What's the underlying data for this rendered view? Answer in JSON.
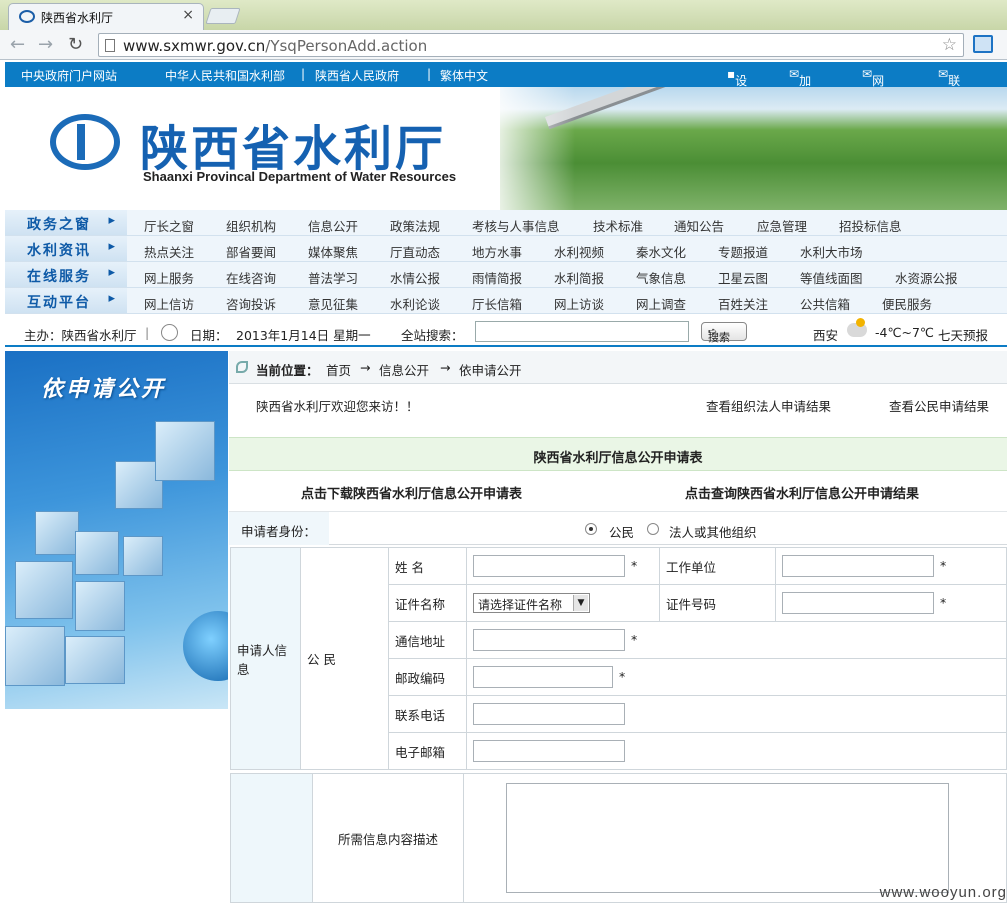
{
  "browser": {
    "tab_title": "陕西省水利厅",
    "url_host": "www.sxmwr.gov.cn",
    "url_path": "/YsqPersonAdd.action"
  },
  "top_links": {
    "left": [
      "中央政府门户网站",
      "中华人民共和国水利部",
      "陕西省人民政府",
      "繁体中文"
    ],
    "right": [
      "设为首页",
      "加入收藏",
      "网站地图",
      "联系我们"
    ]
  },
  "banner": {
    "title": "陕西省水利厅",
    "subtitle": "Shaanxi Provincal Department of Water Resources"
  },
  "nav": [
    {
      "category": "政务之窗",
      "items": [
        "厅长之窗",
        "组织机构",
        "信息公开",
        "政策法规",
        "考核与人事信息",
        "技术标准",
        "通知公告",
        "应急管理",
        "招投标信息"
      ]
    },
    {
      "category": "水利资讯",
      "items": [
        "热点关注",
        "部省要闻",
        "媒体聚焦",
        "厅直动态",
        "地方水事",
        "水利视频",
        "秦水文化",
        "专题报道",
        "水利大市场"
      ]
    },
    {
      "category": "在线服务",
      "items": [
        "网上服务",
        "在线咨询",
        "普法学习",
        "水情公报",
        "雨情简报",
        "水利简报",
        "气象信息",
        "卫星云图",
        "等值线面图",
        "水资源公报"
      ]
    },
    {
      "category": "互动平台",
      "items": [
        "网上信访",
        "咨询投诉",
        "意见征集",
        "水利论谈",
        "厅长信箱",
        "网上访谈",
        "网上调查",
        "百姓关注",
        "公共信箱",
        "便民服务"
      ]
    }
  ],
  "infobar": {
    "host": "主办：陕西省水利厅",
    "date_label": "日期：",
    "date": "2013年1月14日 星期一",
    "search_label": "全站搜索：",
    "search_button": "搜索",
    "city": "西安",
    "temp": "-4℃~7℃",
    "forecast": "七天预报"
  },
  "left_banner": {
    "heading": "依申请公开"
  },
  "breadcrumb": {
    "label": "当前位置：",
    "items": [
      "首页",
      "信息公开",
      "依申请公开"
    ],
    "arrow": "→"
  },
  "welcome": {
    "text": "陕西省水利厅欢迎您来访！！",
    "org_results": "查看组织法人申请结果",
    "citizen_results": "查看公民申请结果"
  },
  "form": {
    "title": "陕西省水利厅信息公开申请表",
    "download_link": "点击下载陕西省水利厅信息公开申请表",
    "query_link": "点击查询陕西省水利厅信息公开申请结果",
    "identity_label": "申请者身份：",
    "identity_options": [
      "公民",
      "法人或其他组织"
    ],
    "identity_selected": "公民",
    "section_label": "申请人信息",
    "section_type": "公 民",
    "fields": {
      "name": "姓 名",
      "work_unit": "工作单位",
      "id_type": "证件名称",
      "id_type_value": "请选择证件名称",
      "id_number": "证件号码",
      "address": "通信地址",
      "postcode": "邮政编码",
      "phone": "联系电话",
      "email": "电子邮箱"
    },
    "required_mark": "*",
    "description_label": "所需信息内容描述"
  },
  "watermark": "www.wooyun.org"
}
